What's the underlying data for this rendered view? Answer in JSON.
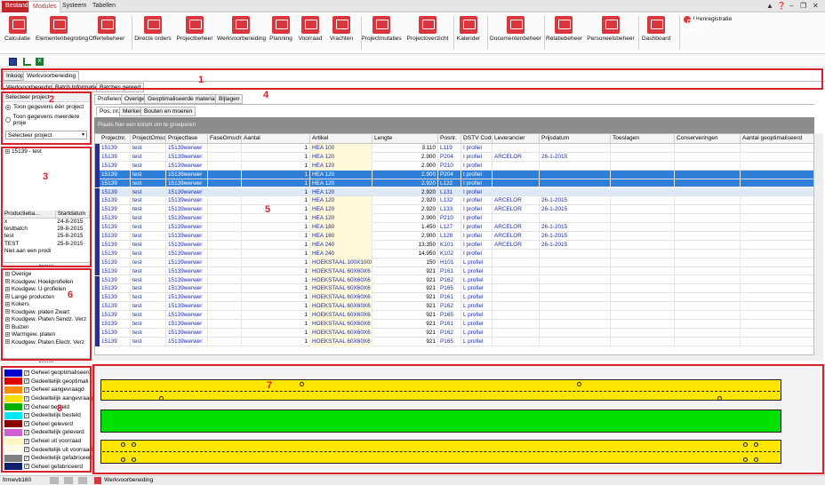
{
  "menu": {
    "tabs": [
      "Bestand",
      "Modules",
      "Systeem",
      "Tabellen"
    ],
    "active": "Modules"
  },
  "ribbon": {
    "buttons": [
      "Calculatie",
      "Elementenbegroting",
      "Offertebeheer",
      "Directe orders",
      "Projectbeheer",
      "Werkvoorbereiding",
      "Planning",
      "Voorraad",
      "Vrachten",
      "Projectmutaties",
      "Projectoverzicht",
      "Kalender",
      "Documentenbeheer",
      "Relatiebeheer",
      "Personeelsbeheer",
      "Dashboard",
      "Urenregistratie"
    ]
  },
  "tabs": {
    "top": [
      "Inkoop",
      "Werkvoorbereiding"
    ],
    "sub": [
      "Werkvoorbereiding",
      "Batch Informatie",
      "Batches gereed"
    ],
    "main": [
      "Profielen",
      "Overige",
      "Geoptimaliseerde materialen",
      "Bijlagen"
    ],
    "grid": [
      "Pos. nr.",
      "Merken",
      "Bouten en moeren"
    ]
  },
  "callouts": [
    "1",
    "2",
    "3",
    "4",
    "5",
    "6",
    "7",
    "8"
  ],
  "project_panel": {
    "title": "Selecteer project",
    "opt1": "Toon gegevens één project",
    "opt2": "Toon gegevens meerdere proje",
    "select": "Selecteer project"
  },
  "tree": {
    "root": "15139 - test"
  },
  "batch_table": {
    "headers": [
      "Productieba...",
      "Startdatum"
    ],
    "rows": [
      [
        "x",
        "24-8-2015"
      ],
      [
        "testbatch",
        "28-8-2015"
      ],
      [
        "test",
        "25-8-2015"
      ],
      [
        "TEST",
        "25-8-2015"
      ],
      [
        "Niet aan een prodi",
        ""
      ]
    ]
  },
  "categories": [
    "Overige",
    "Koudgew. Hoekprofielen",
    "Koudgew. U-profielen",
    "Lange producten",
    "Kokers",
    "Koudgew. platen Zwart",
    "Koudgew. Platen Sendz. Verz",
    "Buizen",
    "Warmgew. platen",
    "Koudgew. Platen Electr. Verz"
  ],
  "legend": [
    {
      "label": "Geheel geoptimaliseerd",
      "color": "#0000cc"
    },
    {
      "label": "Gedeeltelijk geoptimali",
      "color": "#e00000"
    },
    {
      "label": "Geheel aangevraagd",
      "color": "#ff8c00"
    },
    {
      "label": "Gedeeltelijk aangevraagd",
      "color": "#f7e000"
    },
    {
      "label": "Geheel besteld",
      "color": "#00b000"
    },
    {
      "label": "Gedeeltelijk besteld",
      "color": "#00e8f0"
    },
    {
      "label": "Geheel geleverd",
      "color": "#8b0000"
    },
    {
      "label": "Gedeeltelijk geleverd",
      "color": "#d060d0"
    },
    {
      "label": "Geheel uit voorraad",
      "color": "#fff7c0"
    },
    {
      "label": "Gedeeltelijk uit voorraad",
      "color": "#fffbe8"
    },
    {
      "label": "Gedeeltelijk gefabriceerd",
      "color": "#808080"
    },
    {
      "label": "Geheel gefabriceerd",
      "color": "#102070"
    }
  ],
  "grid": {
    "group_hint": "Plaats hier een kolom om te groeperen",
    "columns": [
      "Projectnr.",
      "ProjectOmsch",
      "Projectfase",
      "FaseOmschrij",
      "Aantal",
      "Artikel",
      "Lengte",
      "Posnr.",
      "DSTV Code",
      "Leverancier",
      "Prijsdatum",
      "Toeslagen",
      "Conserveringen",
      "Aantal geoptimaliseerd"
    ],
    "rows": [
      {
        "nr": "15139",
        "om": "test",
        "fase": "15139werwer",
        "aantal": "1",
        "art": "HEA  100",
        "len": "3.110",
        "pos": "L119",
        "dstv": "I profiel",
        "lev": "",
        "pd": "",
        "st": ""
      },
      {
        "nr": "15139",
        "om": "test",
        "fase": "15139werwer",
        "aantal": "1",
        "art": "HEA  120",
        "len": "2.900",
        "pos": "P204",
        "dstv": "I profiel",
        "lev": "ARCELOR",
        "pd": "26-1-2015",
        "st": ""
      },
      {
        "nr": "15139",
        "om": "test",
        "fase": "15139werwer",
        "aantal": "1",
        "art": "HEA  120",
        "len": "2.900",
        "pos": "P210",
        "dstv": "I profiel",
        "lev": "",
        "pd": "",
        "st": ""
      },
      {
        "nr": "15139",
        "om": "test",
        "fase": "15139werwer",
        "aantal": "1",
        "art": "HEA  120",
        "len": "2.900",
        "pos": "P204",
        "dstv": "I profiel",
        "lev": "",
        "pd": "",
        "st": "sel1"
      },
      {
        "nr": "15139",
        "om": "test",
        "fase": "15139werwer",
        "aantal": "1",
        "art": "HEA  120",
        "len": "2.920",
        "pos": "L122",
        "dstv": "I profiel",
        "lev": "",
        "pd": "",
        "st": "sel1"
      },
      {
        "nr": "15139",
        "om": "test",
        "fase": "15139werwer",
        "aantal": "1",
        "art": "HEA  120",
        "len": "2.920",
        "pos": "L131",
        "dstv": "I profiel",
        "lev": "",
        "pd": "",
        "st": "sel2"
      },
      {
        "nr": "15139",
        "om": "test",
        "fase": "15139werwer",
        "aantal": "1",
        "art": "HEA  120",
        "len": "2.920",
        "pos": "L132",
        "dstv": "I profiel",
        "lev": "ARCELOR",
        "pd": "26-1-2015",
        "st": ""
      },
      {
        "nr": "15139",
        "om": "test",
        "fase": "15139werwer",
        "aantal": "1",
        "art": "HEA  120",
        "len": "2.920",
        "pos": "L133",
        "dstv": "I profiel",
        "lev": "ARCELOR",
        "pd": "26-1-2015",
        "st": ""
      },
      {
        "nr": "15139",
        "om": "test",
        "fase": "15139werwer",
        "aantal": "1",
        "art": "HEA  120",
        "len": "2.900",
        "pos": "P210",
        "dstv": "I profiel",
        "lev": "",
        "pd": "",
        "st": ""
      },
      {
        "nr": "15139",
        "om": "test",
        "fase": "15139werwer",
        "aantal": "1",
        "art": "HEA  180",
        "len": "1.450",
        "pos": "L127",
        "dstv": "I profiel",
        "lev": "ARCELOR",
        "pd": "26-1-2015",
        "st": ""
      },
      {
        "nr": "15139",
        "om": "test",
        "fase": "15139werwer",
        "aantal": "1",
        "art": "HEA  180",
        "len": "2.900",
        "pos": "L128",
        "dstv": "I profiel",
        "lev": "ARCELOR",
        "pd": "26-1-2015",
        "st": ""
      },
      {
        "nr": "15139",
        "om": "test",
        "fase": "15139werwer",
        "aantal": "1",
        "art": "HEA  240",
        "len": "13.350",
        "pos": "K101",
        "dstv": "I profiel",
        "lev": "ARCELOR",
        "pd": "26-1-2015",
        "st": ""
      },
      {
        "nr": "15139",
        "om": "test",
        "fase": "15139werwer",
        "aantal": "1",
        "art": "HEA  240",
        "len": "14.950",
        "pos": "K102",
        "dstv": "I profiel",
        "lev": "",
        "pd": "",
        "st": ""
      },
      {
        "nr": "15139",
        "om": "test",
        "fase": "15139werwer",
        "aantal": "1",
        "art": "HOEKSTAAL 100X100X10",
        "len": "150",
        "pos": "H101",
        "dstv": "L profiel",
        "lev": "",
        "pd": "",
        "st": ""
      },
      {
        "nr": "15139",
        "om": "test",
        "fase": "15139werwer",
        "aantal": "1",
        "art": "HOEKSTAAL 60X60X6",
        "len": "921",
        "pos": "P161",
        "dstv": "L profiel",
        "lev": "",
        "pd": "",
        "st": ""
      },
      {
        "nr": "15139",
        "om": "test",
        "fase": "15139werwer",
        "aantal": "1",
        "art": "HOEKSTAAL 60X60X6",
        "len": "921",
        "pos": "P162",
        "dstv": "L profiel",
        "lev": "",
        "pd": "",
        "st": ""
      },
      {
        "nr": "15139",
        "om": "test",
        "fase": "15139werwer",
        "aantal": "1",
        "art": "HOEKSTAAL 60X60X6",
        "len": "921",
        "pos": "P165",
        "dstv": "L profiel",
        "lev": "",
        "pd": "",
        "st": ""
      },
      {
        "nr": "15139",
        "om": "test",
        "fase": "15139werwer",
        "aantal": "1",
        "art": "HOEKSTAAL 60X60X6",
        "len": "921",
        "pos": "P161",
        "dstv": "L profiel",
        "lev": "",
        "pd": "",
        "st": ""
      },
      {
        "nr": "15139",
        "om": "test",
        "fase": "15139werwer",
        "aantal": "1",
        "art": "HOEKSTAAL 60X60X6",
        "len": "921",
        "pos": "P162",
        "dstv": "L profiel",
        "lev": "",
        "pd": "",
        "st": ""
      },
      {
        "nr": "15139",
        "om": "test",
        "fase": "15139werwer",
        "aantal": "1",
        "art": "HOEKSTAAL 60X60X6",
        "len": "921",
        "pos": "P165",
        "dstv": "L profiel",
        "lev": "",
        "pd": "",
        "st": ""
      },
      {
        "nr": "15139",
        "om": "test",
        "fase": "15139werwer",
        "aantal": "1",
        "art": "HOEKSTAAL 60X60X6",
        "len": "921",
        "pos": "P161",
        "dstv": "L profiel",
        "lev": "",
        "pd": "",
        "st": ""
      },
      {
        "nr": "15139",
        "om": "test",
        "fase": "15139werwer",
        "aantal": "1",
        "art": "HOEKSTAAL 60X60X6",
        "len": "921",
        "pos": "P162",
        "dstv": "L profiel",
        "lev": "",
        "pd": "",
        "st": ""
      },
      {
        "nr": "15139",
        "om": "test",
        "fase": "15139werwer",
        "aantal": "1",
        "art": "HOEKSTAAL 60X60X6",
        "len": "921",
        "pos": "P165",
        "dstv": "L profiel",
        "lev": "",
        "pd": "",
        "st": ""
      }
    ]
  },
  "status": {
    "left": "frmwvb160",
    "doc": "Werkvoorbereiding"
  }
}
